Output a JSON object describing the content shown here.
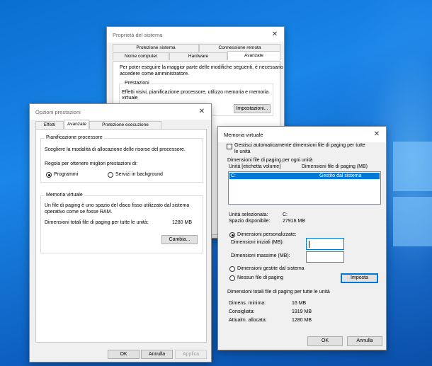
{
  "system_properties": {
    "title": "Proprietà del sistema",
    "tabs_row1": [
      "Protezione sistema",
      "Connessione remota"
    ],
    "tabs_row2": [
      "Nome computer",
      "Hardware",
      "Avanzate"
    ],
    "intro": [
      "Per poter eseguire la maggior parte delle modifiche seguenti, è necessario",
      "accedere come amministratore."
    ],
    "performance_group": {
      "title": "Prestazioni",
      "desc": [
        "Effetti visivi, pianificazione processore, utilizzo memoria e memoria",
        "virtuale"
      ],
      "settings_button": "Impostazioni..."
    }
  },
  "performance_options": {
    "title": "Opzioni prestazioni",
    "tabs": [
      "Effetti visivi",
      "Avanzate",
      "Protezione esecuzione programmi"
    ],
    "scheduling": {
      "title": "Pianificazione processore",
      "desc": "Scegliere la modalità di allocazione delle risorse del processore.",
      "prompt": "Regola per ottenere migliori prestazioni di:",
      "option_programs": "Programmi",
      "option_background": "Servizi in background"
    },
    "virtual_memory": {
      "title": "Memoria virtuale",
      "desc": [
        "Un file di paging è uno spazio del disco fisso utilizzato dal sistema",
        "operativo come se fosse RAM."
      ],
      "total_label": "Dimensioni totali file di paging per tutte le unità:",
      "total_value": "1280 MB",
      "change_button": "Cambia..."
    },
    "buttons": {
      "ok": "OK",
      "cancel": "Annulla",
      "apply": "Applica"
    }
  },
  "virtual_memory_dialog": {
    "title": "Memoria virtuale",
    "auto_manage_label": [
      "Gestisci automaticamente dimensioni file di paging per tutte",
      "le unità"
    ],
    "per_drive_title": "Dimensioni file di paging per ogni unità",
    "col_drive": "Unità [etichetta volume]",
    "col_size": "Dimensioni file di paging (MB)",
    "rows": [
      {
        "drive": "C:",
        "size": "Gestito dal sistema"
      }
    ],
    "selected_drive_label": "Unità selezionata:",
    "selected_drive_value": "C:",
    "free_space_label": "Spazio disponibile:",
    "free_space_value": "27916 MB",
    "custom_size_label": "Dimensioni personalizzate:",
    "initial_size_label": "Dimensioni iniziali (MB):",
    "max_size_label": "Dimensioni massime (MB):",
    "system_managed_label": "Dimensioni gestite dal sistema",
    "no_paging_label": "Nessun file di paging",
    "set_button": "Imposta",
    "totals_title": "Dimensioni totali file di paging per tutte le unità",
    "min_label": "Dimens. minima:",
    "min_value": "16 MB",
    "recommended_label": "Consigliata:",
    "recommended_value": "1919 MB",
    "allocated_label": "Attualm. allocata:",
    "allocated_value": "1280 MB",
    "ok_button": "OK",
    "cancel_button": "Annulla"
  }
}
